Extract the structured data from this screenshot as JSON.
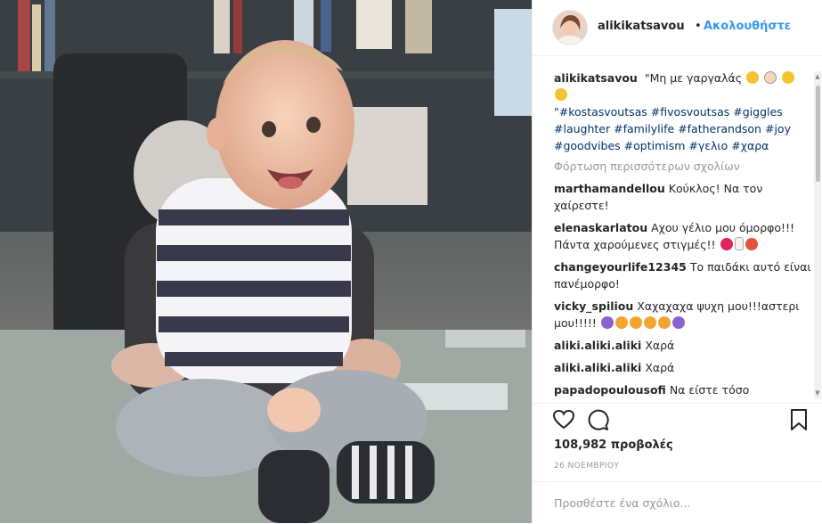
{
  "post": {
    "username": "alikikatsavou",
    "separator": "•",
    "follow_label": "Ακολουθήστε",
    "caption": {
      "username": "alikikatsavou",
      "text": "\"Μη με γαργαλάς",
      "text2": "\"",
      "emojis": [
        "rolling-laughing-emoji",
        "baby-emoji",
        "persevering-face-emoji",
        "tears-of-joy-emoji"
      ],
      "hashtags_line1": [
        "#kostasvoutsas",
        "#fivosvoutsas",
        "#giggles"
      ],
      "hashtags_line2": [
        "#laughter",
        "#familylife",
        "#fatherandson",
        "#joy"
      ],
      "hashtags_line3": [
        "#goodvibes",
        "#optimism",
        "#γελιο",
        "#χαρα"
      ]
    },
    "load_more": "Φόρτωση περισσότερων σχολίων",
    "comments": [
      {
        "user": "marthamandellou",
        "text": "Κούκλος! Να τον χαίρεστε!"
      },
      {
        "user": "elenaskarlatou",
        "text": "Αχου γέλιο μου όμορφο!!! Πάντα χαρούμενες στιγμές!!"
      },
      {
        "user": "changeyourlife12345",
        "text": "Το παιδάκι αυτό είναι πανέμορφο!"
      },
      {
        "user": "vicky_spiliou",
        "text": "Χαχαχαχα ψυχη μου!!!αστερι μου!!!!!"
      },
      {
        "user": "aliki.aliki.aliki",
        "text": "Χαρά"
      },
      {
        "user": "aliki.aliki.aliki",
        "text": "Χαρά"
      },
      {
        "user": "papadopoulousofi",
        "text": "Να είστε τόσο χαρούμενοι πάντα!!!"
      }
    ],
    "views": "108,982 προβολές",
    "date": "26 ΝΟΕΜΒΡΙΟΥ",
    "add_comment_placeholder": "Προσθέστε ένα σχόλιο..."
  },
  "colors": {
    "link": "#003569",
    "follow": "#3897f0",
    "text": "#262626",
    "muted": "#999999"
  }
}
